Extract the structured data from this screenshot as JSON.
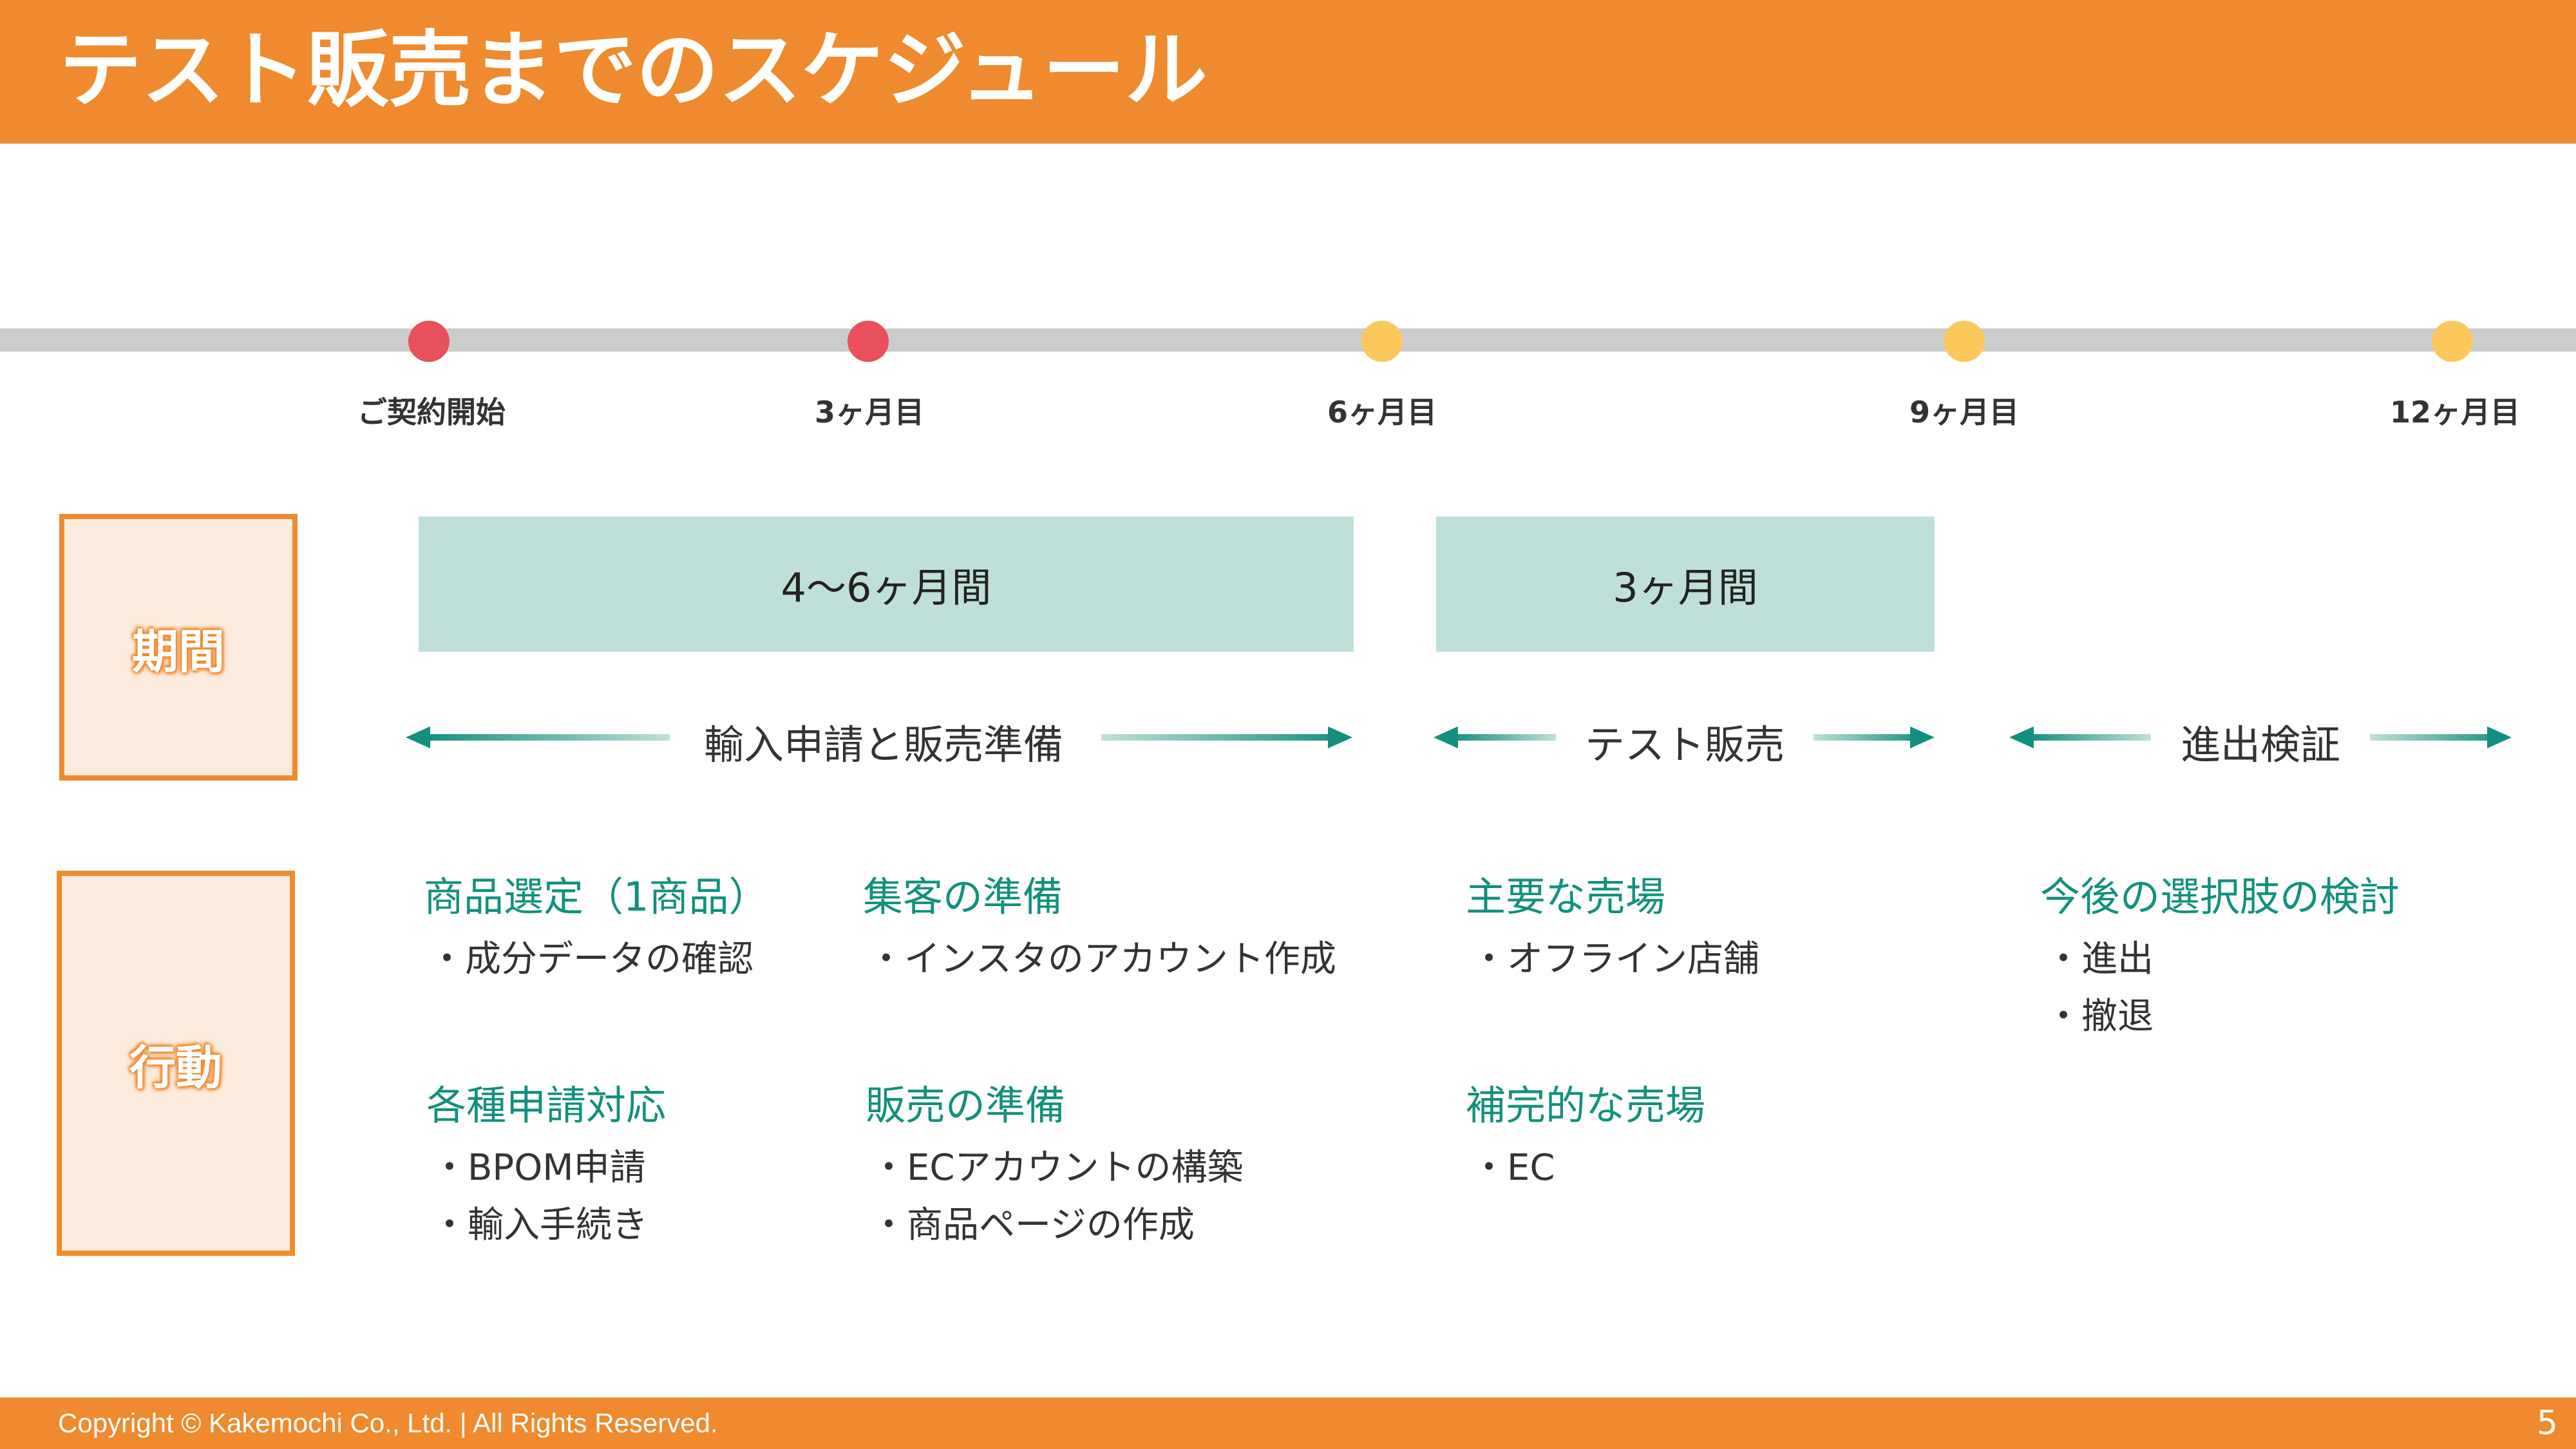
{
  "title": "テスト販売までのスケジュール",
  "timeline": {
    "milestones": [
      {
        "label": "ご契約開始",
        "status": "red"
      },
      {
        "label": "3ヶ月目",
        "status": "red"
      },
      {
        "label": "6ヶ月目",
        "status": "yellow"
      },
      {
        "label": "9ヶ月目",
        "status": "yellow"
      },
      {
        "label": "12ヶ月目",
        "status": "yellow"
      }
    ]
  },
  "rows": {
    "period_label": "期間",
    "action_label": "行動"
  },
  "periods": [
    "4〜6ヶ月間",
    "3ヶ月間"
  ],
  "phases": [
    "輸入申請と販売準備",
    "テスト販売",
    "進出検証"
  ],
  "actions": {
    "product_selection": {
      "heading": "商品選定（1商品）",
      "items": [
        "・成分データの確認"
      ]
    },
    "customer_prep": {
      "heading": "集客の準備",
      "items": [
        "・インスタのアカウント作成"
      ]
    },
    "main_channels": {
      "heading": "主要な売場",
      "items": [
        "・オフライン店舗"
      ]
    },
    "future_options": {
      "heading": "今後の選択肢の検討",
      "items": [
        "・進出",
        "・撤退"
      ]
    },
    "applications": {
      "heading": "各種申請対応",
      "items": [
        "・BPOM申請",
        "・輸入手続き"
      ]
    },
    "sales_prep": {
      "heading": "販売の準備",
      "items": [
        "・ECアカウントの構築",
        "・商品ページの作成"
      ]
    },
    "supplementary_channels": {
      "heading": "補完的な売場",
      "items": [
        "・EC"
      ]
    }
  },
  "footer": {
    "copyright": "Copyright © Kakemochi Co., Ltd. | All Rights Reserved.",
    "page_number": "5"
  },
  "colors": {
    "accent": "#EF8A2F",
    "teal": "#12907D",
    "period_fill": "#BFE0D8",
    "milestone_red": "#E8505B",
    "milestone_yellow": "#FCC85C"
  }
}
